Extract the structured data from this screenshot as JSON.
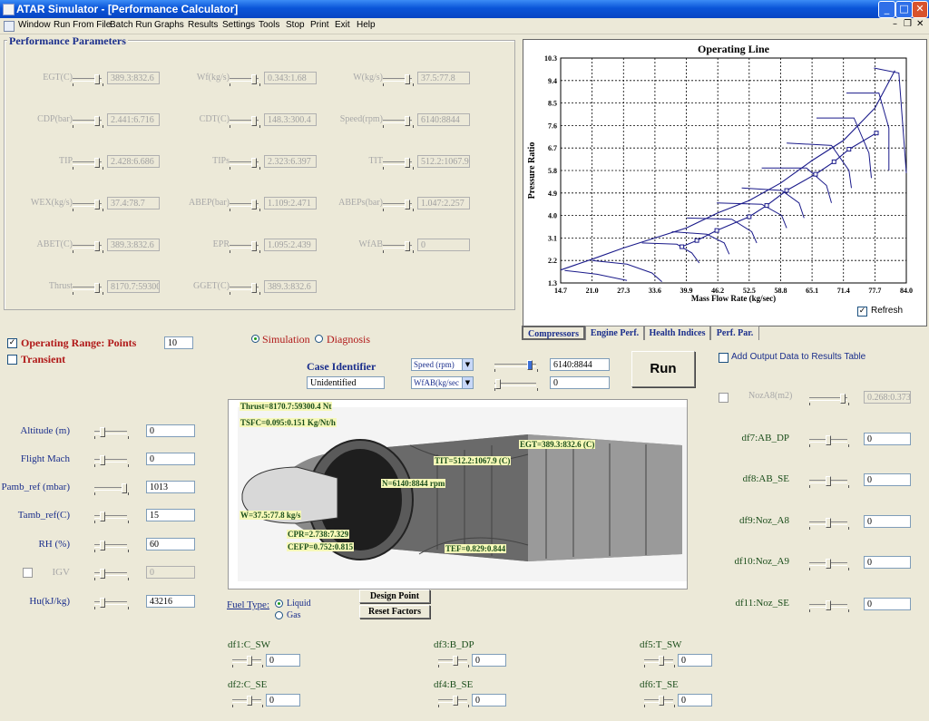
{
  "window": {
    "title": "ATAR Simulator - [Performance Calculator]",
    "icons": {
      "app": "app-icon",
      "minimize": "minimize-icon",
      "maximize": "maximize-icon",
      "close": "close-icon"
    }
  },
  "menu": [
    "Window",
    "Run From File",
    "Batch Run",
    "Graphs",
    "Results",
    "Settings",
    "Tools",
    "Stop",
    "Print",
    "Exit",
    "Help"
  ],
  "perf": {
    "title": "Performance Parameters",
    "params": [
      {
        "label": "EGT(C)",
        "range": "389.3:832.6"
      },
      {
        "label": "Wf(kg/s)",
        "range": "0.343:1.68"
      },
      {
        "label": "W(kg/s)",
        "range": "37.5:77.8"
      },
      {
        "label": "CDP(bar)",
        "range": "2.441:6.716"
      },
      {
        "label": "CDT(C)",
        "range": "148.3:300.4"
      },
      {
        "label": "Speed(rpm)",
        "range": "6140:8844"
      },
      {
        "label": "TIP",
        "range": "2.428:6.686"
      },
      {
        "label": "TIPs",
        "range": "2.323:6.397"
      },
      {
        "label": "TIT",
        "range": "512.2:1067.9"
      },
      {
        "label": "WEX(kg/s)",
        "range": "37.4:78.7"
      },
      {
        "label": "ABEP(bar)",
        "range": "1.109:2.471"
      },
      {
        "label": "ABEPs(bar)",
        "range": "1.047:2.257"
      },
      {
        "label": "ABET(C)",
        "range": "389.3:832.6"
      },
      {
        "label": "EPR",
        "range": "1.095:2.439"
      },
      {
        "label": "WfAB",
        "range": "0"
      },
      {
        "label": "Thrust",
        "range": "8170.7:59300"
      },
      {
        "label": "GGET(C)",
        "range": "389.3:832.6"
      }
    ]
  },
  "chart_data": {
    "type": "line",
    "title": "Operating Line",
    "xlabel": "Mass Flow Rate (kg/sec)",
    "ylabel": "Pressure Ratio",
    "xlim": [
      14.7,
      84.0
    ],
    "ylim": [
      1.3,
      10.3
    ],
    "xticks": [
      "14.7",
      "21.0",
      "27.3",
      "33.6",
      "39.9",
      "46.2",
      "52.5",
      "58.8",
      "65.1",
      "71.4",
      "77.7",
      "84.0"
    ],
    "yticks": [
      "1.3",
      "2.2",
      "3.1",
      "4.0",
      "4.9",
      "5.8",
      "6.7",
      "7.6",
      "8.5",
      "9.4",
      "10.3"
    ],
    "grid": true,
    "series": [
      {
        "name": "",
        "style": "surge-line",
        "x": [
          14.7,
          21.0,
          27.3,
          33.6,
          39.9,
          46.2,
          52.5,
          58.8,
          65.1,
          71.4,
          77.7,
          81.7
        ],
        "y": [
          1.82,
          2.25,
          2.7,
          3.1,
          3.5,
          4.1,
          4.6,
          5.3,
          6.2,
          7.0,
          8.3,
          9.8
        ]
      },
      {
        "name": "",
        "style": "operating-line",
        "x": [
          39.0,
          42.0,
          46.0,
          52.5,
          56.0,
          60.0,
          65.8,
          69.5,
          72.5,
          78.0
        ],
        "y": [
          2.75,
          3.0,
          3.4,
          3.95,
          4.4,
          5.0,
          5.65,
          6.15,
          6.65,
          7.3
        ]
      }
    ],
    "speed_lines": [
      {
        "x": [
          15.5,
          22.0,
          28.0
        ],
        "y": [
          1.8,
          1.65,
          1.4
        ]
      },
      {
        "x": [
          21.0,
          28.0,
          33.0,
          35.0
        ],
        "y": [
          2.2,
          2.05,
          1.7,
          1.35
        ]
      },
      {
        "x": [
          31.0,
          38.0,
          41.0,
          42.5
        ],
        "y": [
          2.9,
          2.85,
          2.5,
          2.1
        ]
      },
      {
        "x": [
          37.0,
          44.0,
          47.5,
          48.5
        ],
        "y": [
          3.35,
          3.25,
          2.9,
          2.45
        ]
      },
      {
        "x": [
          40.0,
          49.0,
          53.0,
          54.0
        ],
        "y": [
          3.9,
          3.85,
          3.35,
          2.9
        ]
      },
      {
        "x": [
          46.0,
          55.0,
          59.0,
          60.0
        ],
        "y": [
          4.5,
          4.45,
          4.0,
          3.5
        ]
      },
      {
        "x": [
          51.0,
          59.0,
          62.5,
          63.5
        ],
        "y": [
          5.1,
          5.0,
          4.5,
          3.9
        ]
      },
      {
        "x": [
          55.0,
          64.0,
          68.0,
          69.0
        ],
        "y": [
          5.9,
          5.9,
          5.2,
          4.5
        ]
      },
      {
        "x": [
          60.0,
          69.0,
          72.5,
          73.0
        ],
        "y": [
          6.9,
          6.8,
          5.8,
          5.1
        ]
      },
      {
        "x": [
          66.0,
          73.5,
          76.5,
          77.0
        ],
        "y": [
          7.9,
          7.9,
          6.5,
          5.5
        ]
      },
      {
        "x": [
          72.0,
          78.5,
          80.5,
          80.5
        ],
        "y": [
          8.9,
          8.9,
          7.5,
          5.8
        ]
      },
      {
        "x": [
          77.5,
          82.5,
          84.0
        ],
        "y": [
          9.9,
          9.7,
          5.7
        ]
      }
    ],
    "refresh_label": "Refresh",
    "refresh_checked": true
  },
  "tabs": [
    "Compressors",
    "Engine Perf.",
    "Health Indices",
    "Perf. Par."
  ],
  "left": {
    "operating_range_label": "Operating Range: Points",
    "operating_range_checked": true,
    "points_value": "10",
    "transient_label": "Transient",
    "transient_checked": false,
    "inputs": [
      {
        "label": "Altitude (m)",
        "value": "0"
      },
      {
        "label": "Flight Mach",
        "value": "0"
      },
      {
        "label": "Pamb_ref (mbar)",
        "value": "1013"
      },
      {
        "label": "Tamb_ref(C)",
        "value": "15"
      },
      {
        "label": "RH (%)",
        "value": "60"
      },
      {
        "label": "IGV",
        "value": "0"
      },
      {
        "label": "Hu(kJ/kg)",
        "value": "43216"
      }
    ]
  },
  "center": {
    "simulation_label": "Simulation",
    "diagnosis_label": "Diagnosis",
    "case_identifier_label": "Case Identifier",
    "case_identifier_value": "Unidentified",
    "combo1": "Speed (rpm)",
    "combo2": "WfAB(kg/sec",
    "combo1_value": "6140:8844",
    "combo2_value": "0",
    "run_label": "Run",
    "fuel_type_label": "Fuel Type:",
    "fuel_liquid": "Liquid",
    "fuel_gas": "Gas",
    "design_point_label": "Design Point",
    "reset_factors_label": "Reset Factors",
    "add_output_label": "Add Output Data to Results Table",
    "annotations": {
      "thrust": "Thrust=8170.7:59300.4 Nt",
      "tsfc": "TSFC=0.095:0.151 Kg/Nt/h",
      "tit": "TIT=512.2:1067.9 (C)",
      "egt": "EGT=389.3:832.6 (C)",
      "n": "N=6140:8844 rpm",
      "w": "W=37.5:77.8 kg/s",
      "cpr": "CPR=2.738:7.329",
      "cefp": "CEFP=0.752:0.815",
      "tef": "TEF=0.829:0.844"
    }
  },
  "right": {
    "noz_label": "NozA8(m2)",
    "noz_value": "0.268:0.373",
    "factors": [
      {
        "label": "df7:AB_DP",
        "value": "0"
      },
      {
        "label": "df8:AB_SE",
        "value": "0"
      },
      {
        "label": "df9:Noz_A8",
        "value": "0"
      },
      {
        "label": "df10:Noz_A9",
        "value": "0"
      },
      {
        "label": "df11:Noz_SE",
        "value": "0"
      }
    ]
  },
  "bottom": [
    {
      "label": "df1:C_SW",
      "value": "0"
    },
    {
      "label": "df2:C_SE",
      "value": "0"
    },
    {
      "label": "df3:B_DP",
      "value": "0"
    },
    {
      "label": "df4:B_SE",
      "value": "0"
    },
    {
      "label": "df5:T_SW",
      "value": "0"
    },
    {
      "label": "df6:T_SE",
      "value": "0"
    }
  ]
}
